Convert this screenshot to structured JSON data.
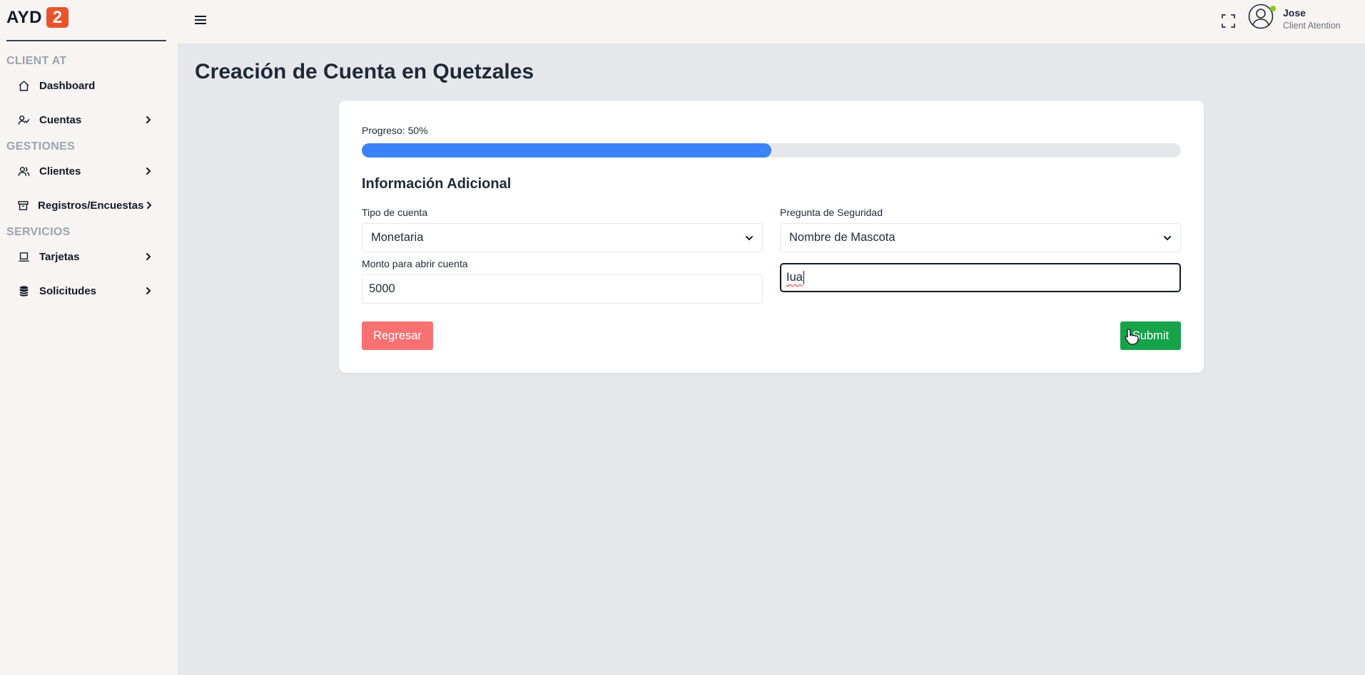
{
  "logo": {
    "text": "AYD",
    "badge": "2"
  },
  "sidebar": {
    "sections": [
      {
        "title": "CLIENT AT"
      },
      {
        "title": "GESTIONES"
      },
      {
        "title": "SERVICIOS"
      }
    ],
    "items": [
      {
        "label": "Dashboard",
        "icon": "home-icon",
        "has_submenu": false
      },
      {
        "label": "Cuentas",
        "icon": "user-check-icon",
        "has_submenu": true
      },
      {
        "label": "Clientes",
        "icon": "users-icon",
        "has_submenu": true
      },
      {
        "label": "Registros/Encuestas",
        "icon": "archive-icon",
        "has_submenu": true
      },
      {
        "label": "Tarjetas",
        "icon": "laptop-icon",
        "has_submenu": true
      },
      {
        "label": "Solicitudes",
        "icon": "database-icon",
        "has_submenu": true
      }
    ]
  },
  "header": {
    "user": {
      "name": "Jose",
      "role": "Client Atention",
      "status_color": "#84cc16"
    }
  },
  "page": {
    "title": "Creación de Cuenta en Quetzales"
  },
  "form": {
    "progress": {
      "label": "Progreso: 50%",
      "value": 0.5
    },
    "section_title": "Información Adicional",
    "account_type": {
      "label": "Tipo de cuenta",
      "value": "Monetaria"
    },
    "security_question": {
      "label": "Pregunta de Seguridad",
      "value": "Nombre de Mascota"
    },
    "opening_amount": {
      "label": "Monto para abrir cuenta",
      "value": "5000"
    },
    "security_answer": {
      "value": "Iua"
    },
    "back_button": "Regresar",
    "submit_button": "Submit"
  },
  "colors": {
    "accent_blue": "#3b82f6",
    "back_button": "#f87171",
    "submit_button": "#16a34a",
    "logo_badge": "#e9532b"
  }
}
